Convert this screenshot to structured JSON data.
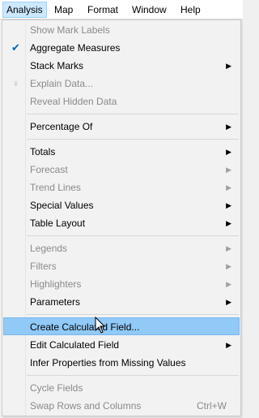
{
  "menubar": {
    "items": [
      {
        "label": "Analysis"
      },
      {
        "label": "Map"
      },
      {
        "label": "Format"
      },
      {
        "label": "Window"
      },
      {
        "label": "Help"
      }
    ]
  },
  "menu": {
    "items": [
      {
        "label": "Show Mark Labels",
        "disabled": true
      },
      {
        "label": "Aggregate Measures",
        "checked": true
      },
      {
        "label": "Stack Marks",
        "submenu": true
      },
      {
        "label": "Explain Data...",
        "disabled": true,
        "icon": "lightbulb-icon"
      },
      {
        "label": "Reveal Hidden Data",
        "disabled": true
      },
      {
        "label": "Percentage Of",
        "submenu": true
      },
      {
        "label": "Totals",
        "submenu": true
      },
      {
        "label": "Forecast",
        "disabled": true,
        "submenu": true
      },
      {
        "label": "Trend Lines",
        "disabled": true,
        "submenu": true
      },
      {
        "label": "Special Values",
        "submenu": true
      },
      {
        "label": "Table Layout",
        "submenu": true
      },
      {
        "label": "Legends",
        "disabled": true,
        "submenu": true
      },
      {
        "label": "Filters",
        "disabled": true,
        "submenu": true
      },
      {
        "label": "Highlighters",
        "disabled": true,
        "submenu": true
      },
      {
        "label": "Parameters",
        "submenu": true
      },
      {
        "label": "Create Calculated Field...",
        "highlighted": true
      },
      {
        "label": "Edit Calculated Field",
        "submenu": true
      },
      {
        "label": "Infer Properties from Missing Values"
      },
      {
        "label": "Cycle Fields",
        "disabled": true
      },
      {
        "label": "Swap Rows and Columns",
        "disabled": true,
        "shortcut": "Ctrl+W"
      }
    ]
  },
  "colors": {
    "highlight": "#91c9f7",
    "active_menu_bg": "#cce8ff",
    "check": "#0063b1",
    "disabled_text": "#8a8a8a"
  }
}
